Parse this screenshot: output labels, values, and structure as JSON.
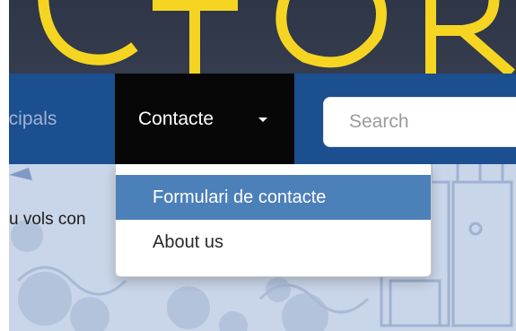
{
  "banner": {
    "logo_fragment": "CTOR",
    "logo_color": "#f5d521"
  },
  "navbar": {
    "prev_item_label": "ncipals",
    "dropdown_label": "Contacte",
    "search": {
      "placeholder": "Search",
      "value": ""
    },
    "background": "#1b4f8f",
    "active_background": "#070707"
  },
  "dropdown_menu": {
    "items": [
      {
        "label": "Formulari de contacte",
        "highlighted": true
      },
      {
        "label": "About us",
        "highlighted": false
      }
    ],
    "highlight_color": "#4c80b9"
  },
  "content": {
    "partial_text": "u vols con"
  },
  "icons": {
    "caret": "caret-down-icon"
  }
}
